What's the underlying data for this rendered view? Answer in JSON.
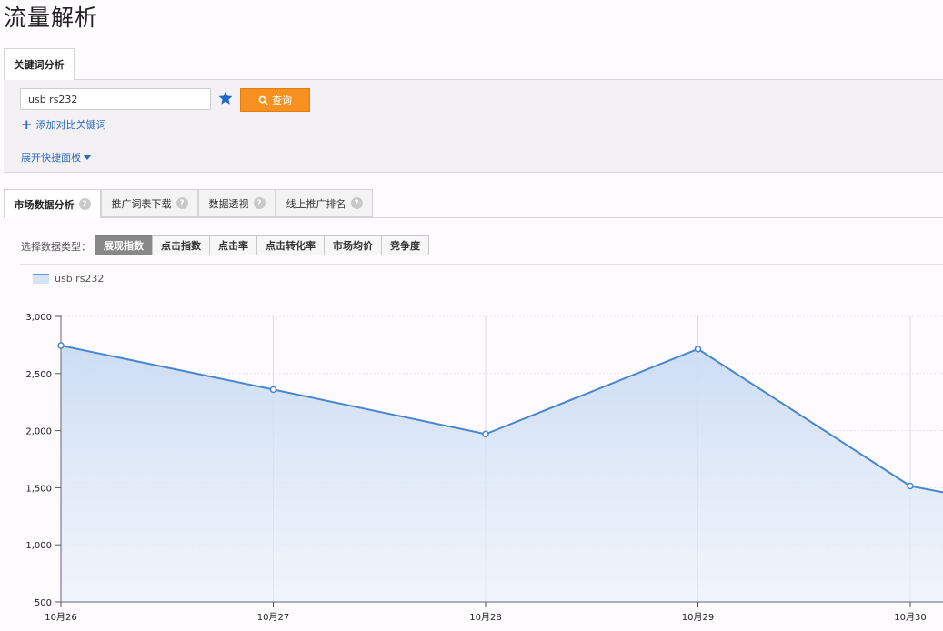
{
  "page": {
    "title": "流量解析"
  },
  "top_tabs": [
    {
      "label": "关键词分析",
      "active": true
    }
  ],
  "search": {
    "keyword_value": "usb rs232",
    "query_label": "查询",
    "add_compare_label": "添加对比关键词",
    "expand_panel_label": "展开快捷面板"
  },
  "sub_tabs": [
    {
      "label": "市场数据分析",
      "active": true
    },
    {
      "label": "推广词表下载",
      "active": false
    },
    {
      "label": "数据透视",
      "active": false
    },
    {
      "label": "线上推广排名",
      "active": false
    }
  ],
  "data_type": {
    "label": "选择数据类型：",
    "options": [
      {
        "label": "展现指数",
        "active": true
      },
      {
        "label": "点击指数",
        "active": false
      },
      {
        "label": "点击率",
        "active": false
      },
      {
        "label": "点击转化率",
        "active": false
      },
      {
        "label": "市场均价",
        "active": false
      },
      {
        "label": "竞争度",
        "active": false
      }
    ]
  },
  "colors": {
    "accent": "#f7901e",
    "link": "#2a6bc0",
    "series_line": "#4a86cf",
    "series_fill": "#d6e3f5"
  },
  "chart_data": {
    "type": "area",
    "x": [
      "10月26",
      "10月27",
      "10月28",
      "10月29",
      "10月30"
    ],
    "series": [
      {
        "name": "usb rs232",
        "values": [
          2745,
          2360,
          1970,
          2715,
          1515
        ]
      }
    ],
    "last_partial_value": 1460,
    "ylim": [
      500,
      3000
    ],
    "yticks": [
      500,
      1000,
      1500,
      2000,
      2500,
      3000
    ],
    "ytick_labels": [
      "500",
      "1,000",
      "1,500",
      "2,000",
      "2,500",
      "3,000"
    ],
    "grid": true,
    "legend": "top-left"
  }
}
